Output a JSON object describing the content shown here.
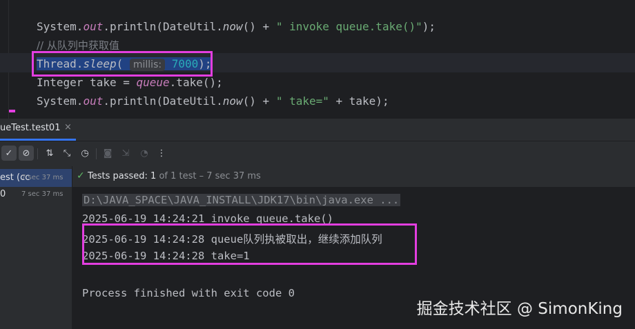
{
  "editor": {
    "line1": {
      "p1": "System.",
      "fld": "out",
      "p2": ".println(DateUtil.",
      "stm": "now",
      "p3": "() + ",
      "str": "\" invoke queue.take()\"",
      "p4": ");"
    },
    "line2": {
      "comment": "// 从队列中获取值"
    },
    "line3": {
      "cls": "Thread.",
      "stm": "sleep",
      "p1": "( ",
      "hint": "millis:",
      "num": "7000",
      "p2": ");"
    },
    "line4": {
      "p1": "Integer take = ",
      "fld": "queue",
      "p2": ".take();"
    },
    "line5": {
      "p1": "System.",
      "fld": "out",
      "p2": ".println(DateUtil.",
      "stm": "now",
      "p3": "() + ",
      "str": "\" take=\"",
      "p4": " + take);"
    }
  },
  "run_tab": {
    "label": "ueTest.test01",
    "close": "×"
  },
  "toolbar": {
    "icons": [
      "check-icon",
      "stop-icon",
      "sort-icon",
      "collapse-icon",
      "history-icon",
      "camera-icon",
      "export-icon",
      "gauge-icon",
      "more-icon"
    ],
    "glyphs": {
      "check": "✓",
      "stop": "⊘",
      "sort": "⇅",
      "collapse": "⤡",
      "history": "◷",
      "camera": "◙",
      "export": "⇲",
      "gauge": "◔",
      "more": "⋮"
    }
  },
  "test_tree": [
    {
      "label": "est (cc",
      "time": "7 sec 37 ms"
    },
    {
      "label": "0",
      "time": "7 sec 37 ms"
    }
  ],
  "status": {
    "passed": "Tests passed: ",
    "count": "1",
    "rest": " of 1 test – 7 sec 37 ms"
  },
  "console": {
    "lines": [
      "D:\\JAVA_SPACE\\JAVA_INSTALL\\JDK17\\bin\\java.exe ...",
      "2025-06-19 14:24:21 invoke queue.take()",
      "2025-06-19 14:24:28 queue队列执被取出，继续添加队列",
      "2025-06-19 14:24:28 take=1",
      "",
      "Process finished with exit code 0"
    ]
  },
  "watermark": "掘金技术社区 @ SimonKing",
  "colors": {
    "highlight_box": "#e33ee0",
    "selection": "#214283",
    "string": "#6aab73",
    "field": "#c77dbb",
    "number": "#2aacb8"
  }
}
